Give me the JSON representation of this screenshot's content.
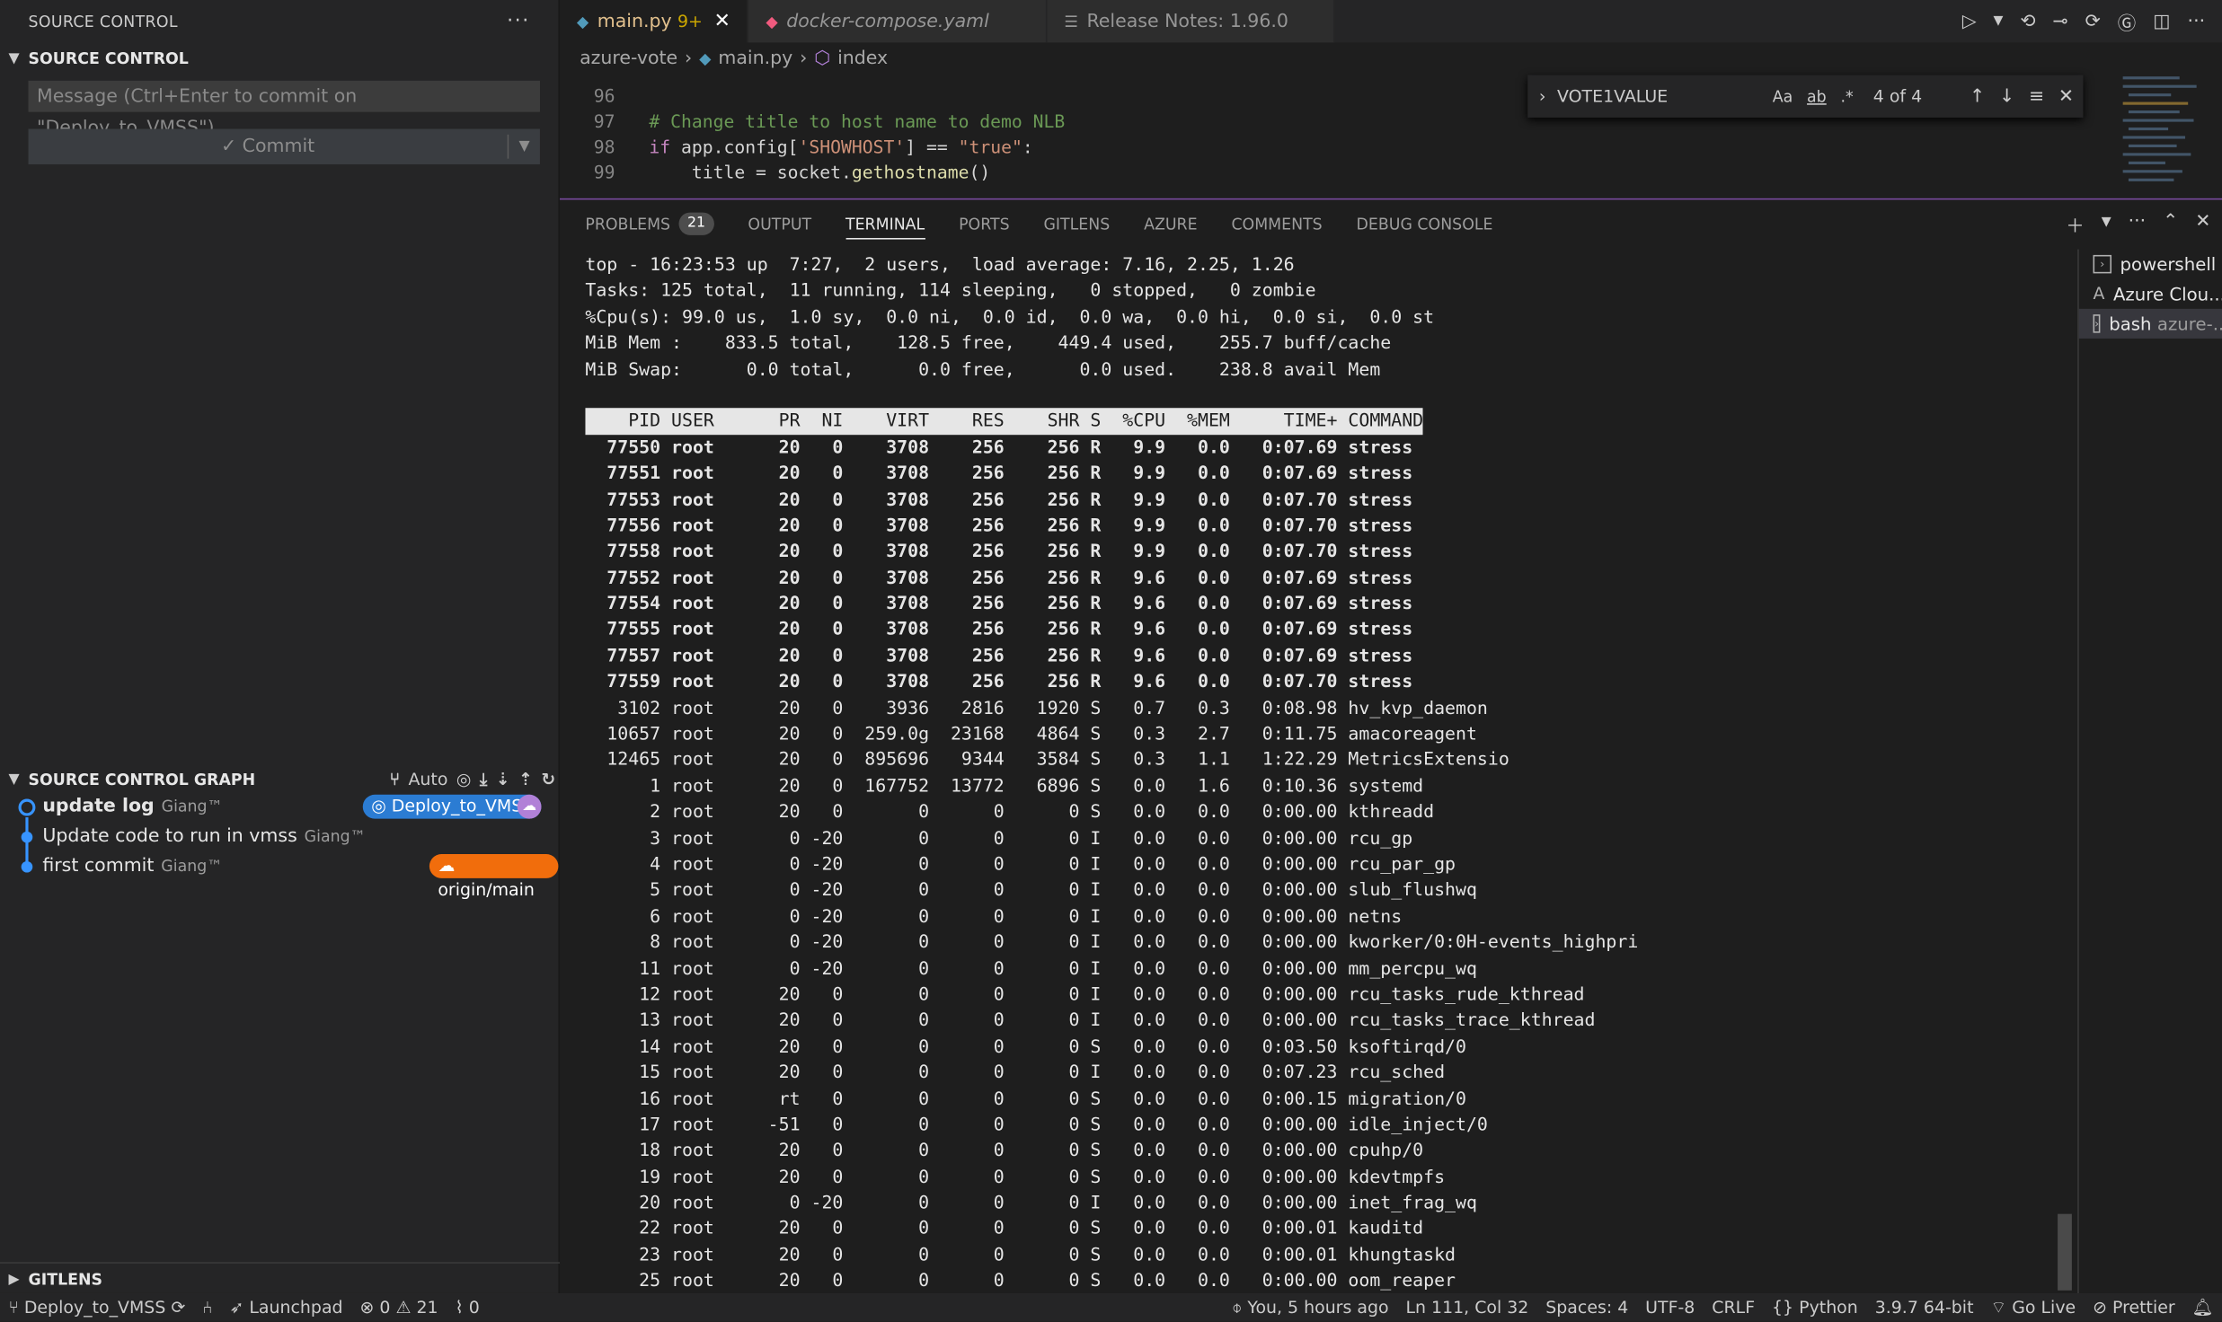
{
  "sidebar": {
    "view_title": "SOURCE CONTROL",
    "section_title": "SOURCE CONTROL",
    "message_placeholder": "Message (Ctrl+Enter to commit on \"Deploy_to_VMSS\")",
    "commit_label": "✓ Commit",
    "graph_title": "SOURCE CONTROL GRAPH",
    "graph_auto": "Auto",
    "commits": [
      {
        "message": "update log",
        "author": "Giang™"
      },
      {
        "message": "Update code to run in vmss",
        "author": "Giang™"
      },
      {
        "message": "first commit",
        "author": "Giang™"
      }
    ],
    "branch_badge": "Deploy_to_VMSS",
    "origin_badge": "origin/main",
    "gitlens_title": "GITLENS"
  },
  "editor": {
    "tabs": [
      {
        "label": "main.py",
        "modified": "9+",
        "icon": "python-icon",
        "color": "#519aba"
      },
      {
        "label": "docker-compose.yaml",
        "icon": "docker-icon",
        "color": "#f05a7e"
      },
      {
        "label": "Release Notes: 1.96.0",
        "icon": "notes-icon",
        "color": "#cccccc"
      }
    ],
    "breadcrumb": [
      "azure-vote",
      "main.py",
      "index"
    ],
    "code_lines": [
      {
        "num": "96",
        "text": ""
      },
      {
        "num": "97",
        "comment": "# Change title to host name to demo NLB"
      },
      {
        "num": "98",
        "kw": "if",
        "pre": " app.config[",
        "str1": "'SHOWHOST'",
        "mid": "] == ",
        "str2": "\"true\"",
        "post": ":"
      },
      {
        "num": "99",
        "indent": "    title = socket.",
        "fn": "gethostname",
        "tail": "()"
      }
    ],
    "find": {
      "query": "VOTE1VALUE",
      "opt_case": "Aa",
      "opt_word": "ab",
      "opt_regex": ".*",
      "result": "4 of 4"
    }
  },
  "panel": {
    "tabs": [
      {
        "label": "PROBLEMS",
        "count": "21"
      },
      {
        "label": "OUTPUT"
      },
      {
        "label": "TERMINAL",
        "active": true
      },
      {
        "label": "PORTS"
      },
      {
        "label": "GITLENS"
      },
      {
        "label": "AZURE"
      },
      {
        "label": "COMMENTS"
      },
      {
        "label": "DEBUG CONSOLE"
      }
    ],
    "terminal_header": [
      "top - 16:23:53 up  7:27,  2 users,  load average: 7.16, 2.25, 1.26",
      "Tasks: 125 total,  11 running, 114 sleeping,   0 stopped,   0 zombie",
      "%Cpu(s): 99.0 us,  1.0 sy,  0.0 ni,  0.0 id,  0.0 wa,  0.0 hi,  0.0 si,  0.0 st",
      "MiB Mem :    833.5 total,    128.5 free,    449.4 used,    255.7 buff/cache",
      "MiB Swap:      0.0 total,      0.0 free,      0.0 used.    238.8 avail Mem"
    ],
    "table_header": "    PID USER      PR  NI    VIRT    RES    SHR S  %CPU  %MEM     TIME+ COMMAND",
    "processes": [
      {
        "pid": "77550",
        "user": "root",
        "pr": "20",
        "ni": "0",
        "virt": "3708",
        "res": "256",
        "shr": "256",
        "s": "R",
        "cpu": "9.9",
        "mem": "0.0",
        "time": "0:07.69",
        "cmd": "stress",
        "bold": true
      },
      {
        "pid": "77551",
        "user": "root",
        "pr": "20",
        "ni": "0",
        "virt": "3708",
        "res": "256",
        "shr": "256",
        "s": "R",
        "cpu": "9.9",
        "mem": "0.0",
        "time": "0:07.69",
        "cmd": "stress",
        "bold": true
      },
      {
        "pid": "77553",
        "user": "root",
        "pr": "20",
        "ni": "0",
        "virt": "3708",
        "res": "256",
        "shr": "256",
        "s": "R",
        "cpu": "9.9",
        "mem": "0.0",
        "time": "0:07.70",
        "cmd": "stress",
        "bold": true
      },
      {
        "pid": "77556",
        "user": "root",
        "pr": "20",
        "ni": "0",
        "virt": "3708",
        "res": "256",
        "shr": "256",
        "s": "R",
        "cpu": "9.9",
        "mem": "0.0",
        "time": "0:07.70",
        "cmd": "stress",
        "bold": true
      },
      {
        "pid": "77558",
        "user": "root",
        "pr": "20",
        "ni": "0",
        "virt": "3708",
        "res": "256",
        "shr": "256",
        "s": "R",
        "cpu": "9.9",
        "mem": "0.0",
        "time": "0:07.70",
        "cmd": "stress",
        "bold": true
      },
      {
        "pid": "77552",
        "user": "root",
        "pr": "20",
        "ni": "0",
        "virt": "3708",
        "res": "256",
        "shr": "256",
        "s": "R",
        "cpu": "9.6",
        "mem": "0.0",
        "time": "0:07.69",
        "cmd": "stress",
        "bold": true
      },
      {
        "pid": "77554",
        "user": "root",
        "pr": "20",
        "ni": "0",
        "virt": "3708",
        "res": "256",
        "shr": "256",
        "s": "R",
        "cpu": "9.6",
        "mem": "0.0",
        "time": "0:07.69",
        "cmd": "stress",
        "bold": true
      },
      {
        "pid": "77555",
        "user": "root",
        "pr": "20",
        "ni": "0",
        "virt": "3708",
        "res": "256",
        "shr": "256",
        "s": "R",
        "cpu": "9.6",
        "mem": "0.0",
        "time": "0:07.69",
        "cmd": "stress",
        "bold": true
      },
      {
        "pid": "77557",
        "user": "root",
        "pr": "20",
        "ni": "0",
        "virt": "3708",
        "res": "256",
        "shr": "256",
        "s": "R",
        "cpu": "9.6",
        "mem": "0.0",
        "time": "0:07.69",
        "cmd": "stress",
        "bold": true
      },
      {
        "pid": "77559",
        "user": "root",
        "pr": "20",
        "ni": "0",
        "virt": "3708",
        "res": "256",
        "shr": "256",
        "s": "R",
        "cpu": "9.6",
        "mem": "0.0",
        "time": "0:07.70",
        "cmd": "stress",
        "bold": true
      },
      {
        "pid": "3102",
        "user": "root",
        "pr": "20",
        "ni": "0",
        "virt": "3936",
        "res": "2816",
        "shr": "1920",
        "s": "S",
        "cpu": "0.7",
        "mem": "0.3",
        "time": "0:08.98",
        "cmd": "hv_kvp_daemon"
      },
      {
        "pid": "10657",
        "user": "root",
        "pr": "20",
        "ni": "0",
        "virt": "259.0g",
        "res": "23168",
        "shr": "4864",
        "s": "S",
        "cpu": "0.3",
        "mem": "2.7",
        "time": "0:11.75",
        "cmd": "amacoreagent"
      },
      {
        "pid": "12465",
        "user": "root",
        "pr": "20",
        "ni": "0",
        "virt": "895696",
        "res": "9344",
        "shr": "3584",
        "s": "S",
        "cpu": "0.3",
        "mem": "1.1",
        "time": "1:22.29",
        "cmd": "MetricsExtensio"
      },
      {
        "pid": "1",
        "user": "root",
        "pr": "20",
        "ni": "0",
        "virt": "167752",
        "res": "13772",
        "shr": "6896",
        "s": "S",
        "cpu": "0.0",
        "mem": "1.6",
        "time": "0:10.36",
        "cmd": "systemd"
      },
      {
        "pid": "2",
        "user": "root",
        "pr": "20",
        "ni": "0",
        "virt": "0",
        "res": "0",
        "shr": "0",
        "s": "S",
        "cpu": "0.0",
        "mem": "0.0",
        "time": "0:00.00",
        "cmd": "kthreadd"
      },
      {
        "pid": "3",
        "user": "root",
        "pr": "0",
        "ni": "-20",
        "virt": "0",
        "res": "0",
        "shr": "0",
        "s": "I",
        "cpu": "0.0",
        "mem": "0.0",
        "time": "0:00.00",
        "cmd": "rcu_gp"
      },
      {
        "pid": "4",
        "user": "root",
        "pr": "0",
        "ni": "-20",
        "virt": "0",
        "res": "0",
        "shr": "0",
        "s": "I",
        "cpu": "0.0",
        "mem": "0.0",
        "time": "0:00.00",
        "cmd": "rcu_par_gp"
      },
      {
        "pid": "5",
        "user": "root",
        "pr": "0",
        "ni": "-20",
        "virt": "0",
        "res": "0",
        "shr": "0",
        "s": "I",
        "cpu": "0.0",
        "mem": "0.0",
        "time": "0:00.00",
        "cmd": "slub_flushwq"
      },
      {
        "pid": "6",
        "user": "root",
        "pr": "0",
        "ni": "-20",
        "virt": "0",
        "res": "0",
        "shr": "0",
        "s": "I",
        "cpu": "0.0",
        "mem": "0.0",
        "time": "0:00.00",
        "cmd": "netns"
      },
      {
        "pid": "8",
        "user": "root",
        "pr": "0",
        "ni": "-20",
        "virt": "0",
        "res": "0",
        "shr": "0",
        "s": "I",
        "cpu": "0.0",
        "mem": "0.0",
        "time": "0:00.00",
        "cmd": "kworker/0:0H-events_highpri"
      },
      {
        "pid": "11",
        "user": "root",
        "pr": "0",
        "ni": "-20",
        "virt": "0",
        "res": "0",
        "shr": "0",
        "s": "I",
        "cpu": "0.0",
        "mem": "0.0",
        "time": "0:00.00",
        "cmd": "mm_percpu_wq"
      },
      {
        "pid": "12",
        "user": "root",
        "pr": "20",
        "ni": "0",
        "virt": "0",
        "res": "0",
        "shr": "0",
        "s": "I",
        "cpu": "0.0",
        "mem": "0.0",
        "time": "0:00.00",
        "cmd": "rcu_tasks_rude_kthread"
      },
      {
        "pid": "13",
        "user": "root",
        "pr": "20",
        "ni": "0",
        "virt": "0",
        "res": "0",
        "shr": "0",
        "s": "I",
        "cpu": "0.0",
        "mem": "0.0",
        "time": "0:00.00",
        "cmd": "rcu_tasks_trace_kthread"
      },
      {
        "pid": "14",
        "user": "root",
        "pr": "20",
        "ni": "0",
        "virt": "0",
        "res": "0",
        "shr": "0",
        "s": "S",
        "cpu": "0.0",
        "mem": "0.0",
        "time": "0:03.50",
        "cmd": "ksoftirqd/0"
      },
      {
        "pid": "15",
        "user": "root",
        "pr": "20",
        "ni": "0",
        "virt": "0",
        "res": "0",
        "shr": "0",
        "s": "I",
        "cpu": "0.0",
        "mem": "0.0",
        "time": "0:07.23",
        "cmd": "rcu_sched"
      },
      {
        "pid": "16",
        "user": "root",
        "pr": "rt",
        "ni": "0",
        "virt": "0",
        "res": "0",
        "shr": "0",
        "s": "S",
        "cpu": "0.0",
        "mem": "0.0",
        "time": "0:00.15",
        "cmd": "migration/0"
      },
      {
        "pid": "17",
        "user": "root",
        "pr": "-51",
        "ni": "0",
        "virt": "0",
        "res": "0",
        "shr": "0",
        "s": "S",
        "cpu": "0.0",
        "mem": "0.0",
        "time": "0:00.00",
        "cmd": "idle_inject/0"
      },
      {
        "pid": "18",
        "user": "root",
        "pr": "20",
        "ni": "0",
        "virt": "0",
        "res": "0",
        "shr": "0",
        "s": "S",
        "cpu": "0.0",
        "mem": "0.0",
        "time": "0:00.00",
        "cmd": "cpuhp/0"
      },
      {
        "pid": "19",
        "user": "root",
        "pr": "20",
        "ni": "0",
        "virt": "0",
        "res": "0",
        "shr": "0",
        "s": "S",
        "cpu": "0.0",
        "mem": "0.0",
        "time": "0:00.00",
        "cmd": "kdevtmpfs"
      },
      {
        "pid": "20",
        "user": "root",
        "pr": "0",
        "ni": "-20",
        "virt": "0",
        "res": "0",
        "shr": "0",
        "s": "I",
        "cpu": "0.0",
        "mem": "0.0",
        "time": "0:00.00",
        "cmd": "inet_frag_wq"
      },
      {
        "pid": "22",
        "user": "root",
        "pr": "20",
        "ni": "0",
        "virt": "0",
        "res": "0",
        "shr": "0",
        "s": "S",
        "cpu": "0.0",
        "mem": "0.0",
        "time": "0:00.01",
        "cmd": "kauditd"
      },
      {
        "pid": "23",
        "user": "root",
        "pr": "20",
        "ni": "0",
        "virt": "0",
        "res": "0",
        "shr": "0",
        "s": "S",
        "cpu": "0.0",
        "mem": "0.0",
        "time": "0:00.01",
        "cmd": "khungtaskd"
      },
      {
        "pid": "25",
        "user": "root",
        "pr": "20",
        "ni": "0",
        "virt": "0",
        "res": "0",
        "shr": "0",
        "s": "S",
        "cpu": "0.0",
        "mem": "0.0",
        "time": "0:00.00",
        "cmd": "oom_reaper"
      }
    ],
    "terminal_list": [
      {
        "label": "powershell",
        "detail": ""
      },
      {
        "label": "Azure Clou...",
        "detail": ""
      },
      {
        "label": "bash",
        "detail": "azure-..."
      }
    ]
  },
  "status": {
    "branch": "Deploy_to_VMSS",
    "launchpad": "Launchpad",
    "errors": "0",
    "warnings": "21",
    "ports": "0",
    "blame": "You, 5 hours ago",
    "position": "Ln 111, Col 32",
    "spaces": "Spaces: 4",
    "encoding": "UTF-8",
    "eol": "CRLF",
    "language": "Python",
    "interpreter": "3.9.7 64-bit",
    "golive": "Go Live",
    "prettier": "Prettier"
  }
}
